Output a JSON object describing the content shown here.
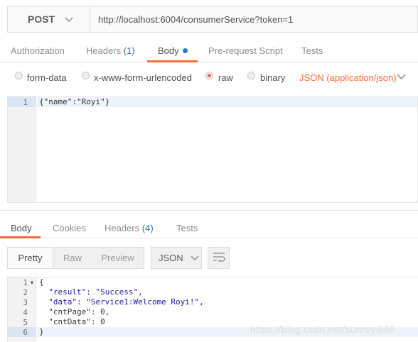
{
  "request": {
    "method": "POST",
    "url": "http://localhost:6004/consumerService?token=1",
    "tabs": [
      {
        "label": "Authorization"
      },
      {
        "label": "Headers",
        "count": "(1)"
      },
      {
        "label": "Body"
      },
      {
        "label": "Pre-request Script"
      },
      {
        "label": "Tests"
      }
    ],
    "body_options": [
      "form-data",
      "x-www-form-urlencoded",
      "raw",
      "binary"
    ],
    "selected_option": "raw",
    "content_type": "JSON (application/json)",
    "editor": {
      "line_numbers": [
        "1"
      ],
      "lines": [
        "{\"name\":\"Royi\"}"
      ]
    }
  },
  "response": {
    "tabs": [
      {
        "label": "Body"
      },
      {
        "label": "Cookies"
      },
      {
        "label": "Headers",
        "count": "(4)"
      },
      {
        "label": "Tests"
      }
    ],
    "view_modes": [
      "Pretty",
      "Raw",
      "Preview"
    ],
    "format": "JSON",
    "line_numbers": [
      "1",
      "2",
      "3",
      "4",
      "5",
      "6"
    ],
    "lines": [
      "{",
      "  \"result\": \"Success\",",
      "  \"data\": \"Service1:Welcome Royi!\",",
      "  \"cntPage\": 0,",
      "  \"cntData\": 0",
      "}"
    ]
  },
  "watermark": "https://blog.csdn.net/sunroyi666",
  "colors": {
    "accent": "#f26b3a",
    "count": "#2a6fbd",
    "dot": "#2a79d7"
  }
}
